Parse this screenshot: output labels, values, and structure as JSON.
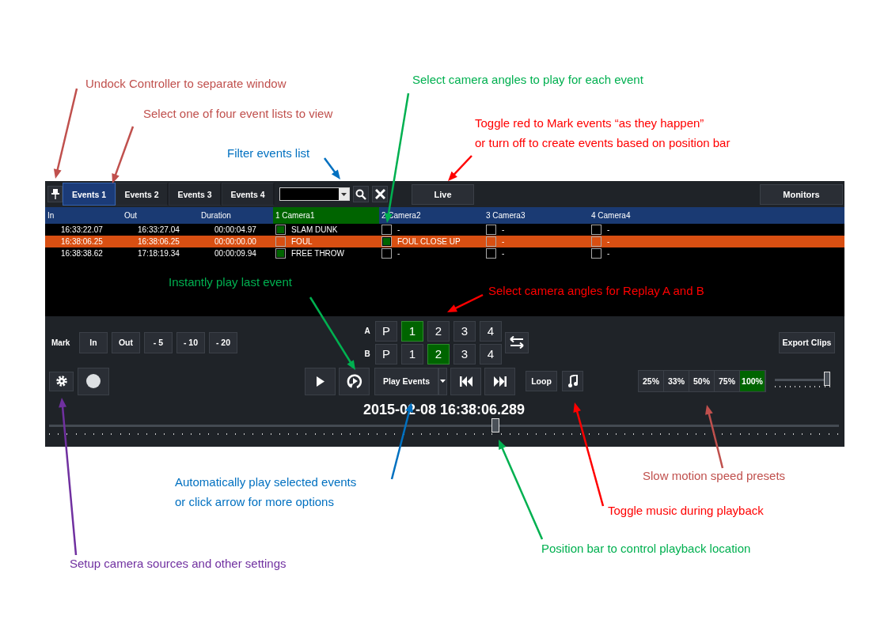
{
  "toolbar": {
    "tabs": [
      {
        "label": "Events 1",
        "selected": true
      },
      {
        "label": "Events 2",
        "selected": false
      },
      {
        "label": "Events 3",
        "selected": false
      },
      {
        "label": "Events 4",
        "selected": false
      }
    ],
    "live": {
      "label": "Live",
      "on": false
    },
    "monitors": "Monitors"
  },
  "table": {
    "columns": [
      {
        "label": "In",
        "highlighted": false
      },
      {
        "label": "Out",
        "highlighted": false
      },
      {
        "label": "Duration",
        "highlighted": false
      },
      {
        "label": "1 Camera1",
        "highlighted": true
      },
      {
        "label": "2 Camera2",
        "highlighted": false
      },
      {
        "label": "3 Camera3",
        "highlighted": false
      },
      {
        "label": "4 Camera4",
        "highlighted": false
      }
    ],
    "rows": [
      {
        "in": "16:33:22.07",
        "out": "16:33:27.04",
        "duration": "00:00:04.97",
        "selected": false,
        "cameras": [
          {
            "checked": true,
            "label": "SLAM DUNK"
          },
          {
            "checked": false,
            "label": "-"
          },
          {
            "checked": false,
            "label": "-"
          },
          {
            "checked": false,
            "label": "-"
          }
        ]
      },
      {
        "in": "16:38:06.25",
        "out": "16:38:06.25",
        "duration": "00:00:00.00",
        "selected": true,
        "cameras": [
          {
            "checked": false,
            "label": "FOUL"
          },
          {
            "checked": true,
            "label": "FOUL CLOSE UP"
          },
          {
            "checked": false,
            "label": "-"
          },
          {
            "checked": false,
            "label": "-"
          }
        ]
      },
      {
        "in": "16:38:38.62",
        "out": "17:18:19.34",
        "duration": "00:00:09.94",
        "selected": false,
        "cameras": [
          {
            "checked": true,
            "label": "FREE THROW"
          },
          {
            "checked": false,
            "label": "-"
          },
          {
            "checked": false,
            "label": "-"
          },
          {
            "checked": false,
            "label": "-"
          }
        ]
      }
    ]
  },
  "mark": {
    "label": "Mark",
    "buttons": [
      "In",
      "Out",
      "- 5",
      "- 10",
      "- 20"
    ]
  },
  "replay": [
    {
      "label": "A",
      "buttons": [
        {
          "label": "P",
          "selected": false
        },
        {
          "label": "1",
          "selected": true
        },
        {
          "label": "2",
          "selected": false
        },
        {
          "label": "3",
          "selected": false
        },
        {
          "label": "4",
          "selected": false
        }
      ]
    },
    {
      "label": "B",
      "buttons": [
        {
          "label": "P",
          "selected": false
        },
        {
          "label": "1",
          "selected": false
        },
        {
          "label": "2",
          "selected": true
        },
        {
          "label": "3",
          "selected": false
        },
        {
          "label": "4",
          "selected": false
        }
      ]
    }
  ],
  "export": "Export Clips",
  "transport": {
    "play_events": "Play Events",
    "loop": "Loop"
  },
  "speeds": [
    {
      "label": "25%",
      "selected": false
    },
    {
      "label": "33%",
      "selected": false
    },
    {
      "label": "50%",
      "selected": false
    },
    {
      "label": "75%",
      "selected": false
    },
    {
      "label": "100%",
      "selected": true
    }
  ],
  "speed_slider": {
    "level": 1
  },
  "timestamp": "2015-02-08 16:38:06.289",
  "position": {
    "level": 0.565
  },
  "annotations": [
    {
      "lines": [
        "Undock Controller to separate window"
      ],
      "color": "#c0504d"
    },
    {
      "lines": [
        "Select camera angles to play for each event"
      ],
      "color": "#00b050"
    },
    {
      "lines": [
        "Select one of four event lists to view"
      ],
      "color": "#c0504d"
    },
    {
      "lines": [
        "Toggle red to Mark events “as they happen”",
        "or turn off to create events based on position bar"
      ],
      "color": "#ff0000"
    },
    {
      "lines": [
        "Filter events list"
      ],
      "color": "#0070c0"
    },
    {
      "lines": [
        "Instantly play last event"
      ],
      "color": "#00b050"
    },
    {
      "lines": [
        "Select camera angles for Replay A and B"
      ],
      "color": "#ff0000"
    },
    {
      "lines": [
        "Slow motion speed presets"
      ],
      "color": "#c0504d"
    },
    {
      "lines": [
        "Automatically play selected events",
        "or click arrow for more options"
      ],
      "color": "#0070c0"
    },
    {
      "lines": [
        "Toggle music during playback"
      ],
      "color": "#ff0000"
    },
    {
      "lines": [
        "Position bar to control playback location"
      ],
      "color": "#00b050"
    },
    {
      "lines": [
        "Setup camera sources and other settings"
      ],
      "color": "#7030a0"
    }
  ]
}
